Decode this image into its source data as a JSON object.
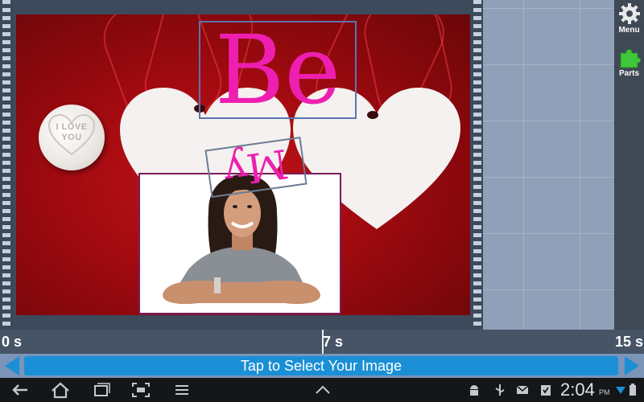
{
  "sidebar": {
    "menu_label": "Menu",
    "parts_label": "Parts"
  },
  "photo": {
    "candy_text_line1": "I LOVE",
    "candy_text_line2": "YOU"
  },
  "overlays": {
    "text1": "Be",
    "text2": "My"
  },
  "timeline": {
    "start_label": "0 s",
    "mid_label": "7 s",
    "end_label": "15 s"
  },
  "select_bar": {
    "label": "Tap to Select Your Image"
  },
  "status_bar": {
    "time": "2:04",
    "ampm": "PM"
  },
  "colors": {
    "accent": "#1a8fd6",
    "text_overlay": "#ee1fb0",
    "sidebar": "#3f4956"
  },
  "icons": [
    "back-icon",
    "home-icon",
    "recent-apps-icon",
    "screenshot-icon",
    "menu-icon",
    "chevron-up-icon",
    "android-icon",
    "usb-icon",
    "email-icon",
    "task-icon",
    "wifi-icon",
    "battery-icon",
    "gear-icon",
    "puzzle-icon"
  ]
}
